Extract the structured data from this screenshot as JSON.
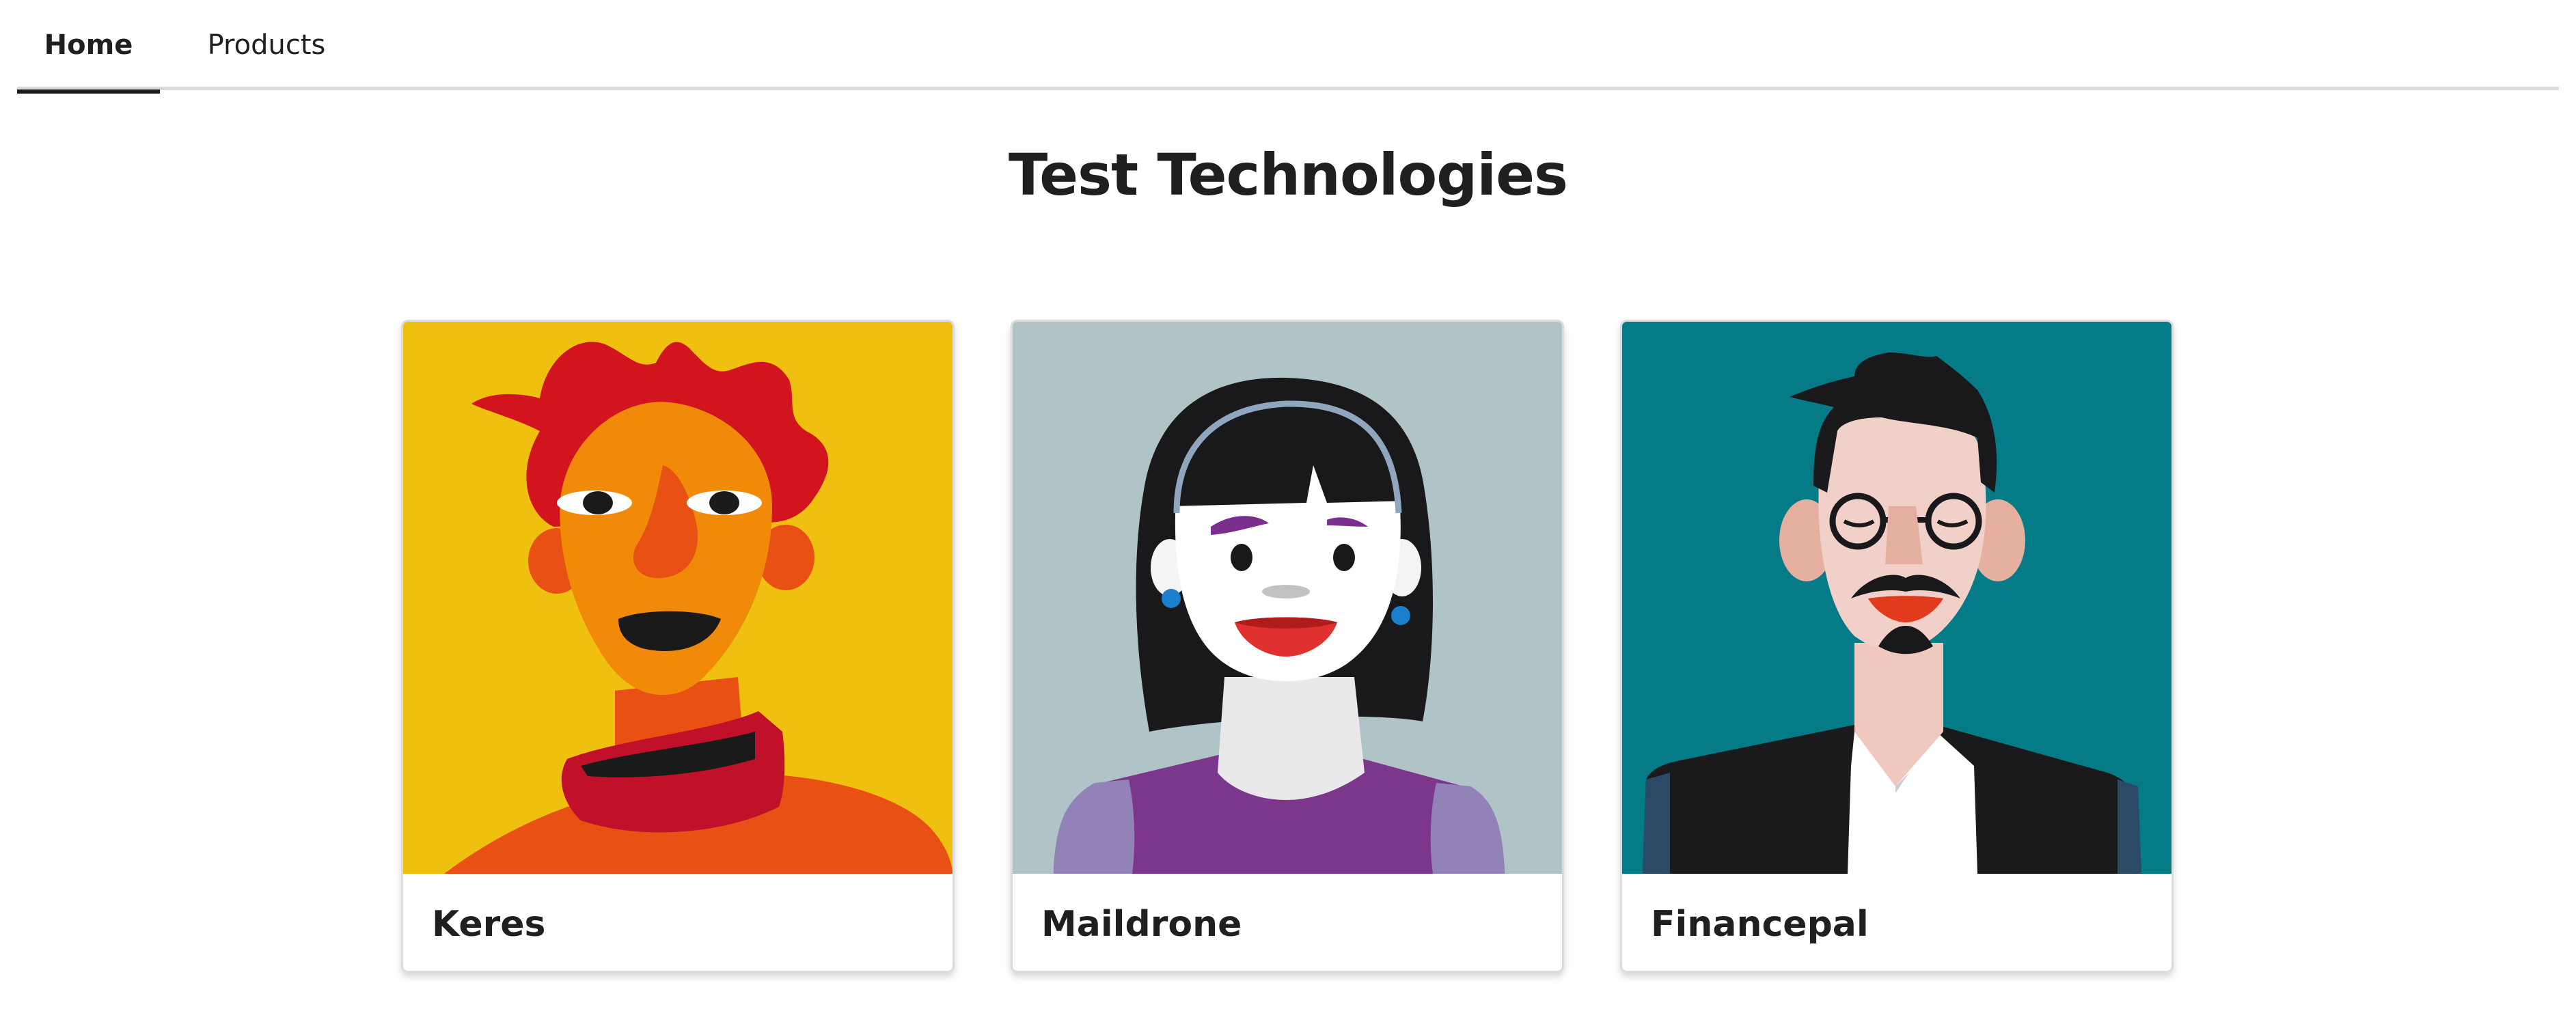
{
  "nav": {
    "tabs": [
      {
        "label": "Home",
        "active": true
      },
      {
        "label": "Products",
        "active": false
      }
    ]
  },
  "page": {
    "title": "Test Technologies"
  },
  "cards": [
    {
      "name": "Keres",
      "illustration": "person-red-hair-portrait",
      "background": "#f0c010"
    },
    {
      "name": "Maildrone",
      "illustration": "person-black-bob-portrait",
      "background": "#b0c4c8"
    },
    {
      "name": "Financepal",
      "illustration": "person-glasses-mustache-portrait",
      "background": "#047b86"
    }
  ]
}
